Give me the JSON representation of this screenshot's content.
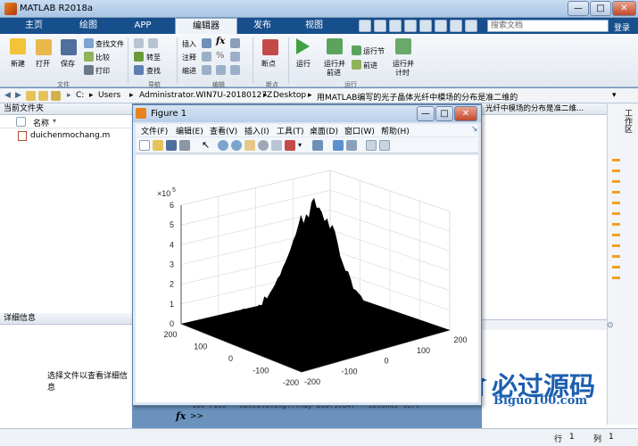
{
  "window": {
    "title": "MATLAB R2018a",
    "minimize": "—",
    "maximize": "□",
    "close": "✕"
  },
  "tabs": [
    {
      "label": "主页",
      "active": false
    },
    {
      "label": "绘图",
      "active": false
    },
    {
      "label": "APP",
      "active": false
    },
    {
      "label": "编辑器",
      "active": true
    },
    {
      "label": "发布",
      "active": false
    },
    {
      "label": "视图",
      "active": false
    }
  ],
  "search": {
    "placeholder": "搜索文档",
    "login": "登录"
  },
  "ribbon": {
    "new": "新建",
    "open": "打开",
    "save": "保存",
    "find_files": "查找文件",
    "compare": "比较",
    "print": "打印",
    "insert": "插入",
    "comment": "注释",
    "indent": "缩进",
    "goto": "转至",
    "find": "查找",
    "breakpoints": "断点",
    "run": "运行",
    "run_advance_1": "运行并",
    "run_advance_2": "前进",
    "run_section": "运行节",
    "advance": "前进",
    "run_time_1": "运行并",
    "run_time_2": "计时",
    "group_file": "文件",
    "group_nav": "导航",
    "group_edit": "编辑",
    "group_bp": "断点",
    "group_run": "运行"
  },
  "path": {
    "c": "C:",
    "users": "Users",
    "admin": "Administrator.WIN7U-20180127Z",
    "desktop": "Desktop",
    "folder": "用MATLAB编写的光子晶体光纤中模场的分布是准二维的"
  },
  "left_panel": {
    "header": "当前文件夹",
    "column_name": "名称",
    "file": "duichenmochang.m",
    "details_header": "详细信息",
    "details_msg": "选择文件以查看详细信息"
  },
  "editor": {
    "tab_title": "光纤中模场的分布是准二维...",
    "side_label": "工作区"
  },
  "figure": {
    "title": "Figure 1",
    "menu": [
      "文件(F)",
      "编辑(E)",
      "查看(V)",
      "插入(I)",
      "工具(T)",
      "桌面(D)",
      "窗口(W)",
      "帮助(H)"
    ],
    "exponent_base": "×10",
    "exponent_power": "5"
  },
  "chart_data": {
    "type": "surface",
    "title": "",
    "z_ticks": [
      "0",
      "1",
      "2",
      "3",
      "4",
      "5",
      "6"
    ],
    "zlim": [
      0,
      600000
    ],
    "x_ticks": [
      "200",
      "100",
      "0",
      "-100",
      "-200"
    ],
    "y_ticks": [
      "200",
      "100",
      "0",
      "-100",
      "-200"
    ],
    "xlim": [
      -200,
      200
    ],
    "ylim": [
      -200,
      200
    ],
    "peak_value": 560000,
    "grid": true,
    "colors": {
      "surface": "#000000",
      "grid": "#d7d7d7",
      "axis": "#262626"
    }
  },
  "command": {
    "line": "100 /100   Calculating...May be0.99847   seconds left",
    "prompt": ">>",
    "fx": "fx"
  },
  "status": {
    "row_label": "行",
    "row": "1",
    "col_label": "列",
    "col": "1"
  },
  "watermark": {
    "cn": "必过源码",
    "en": "Biguo100.com"
  }
}
